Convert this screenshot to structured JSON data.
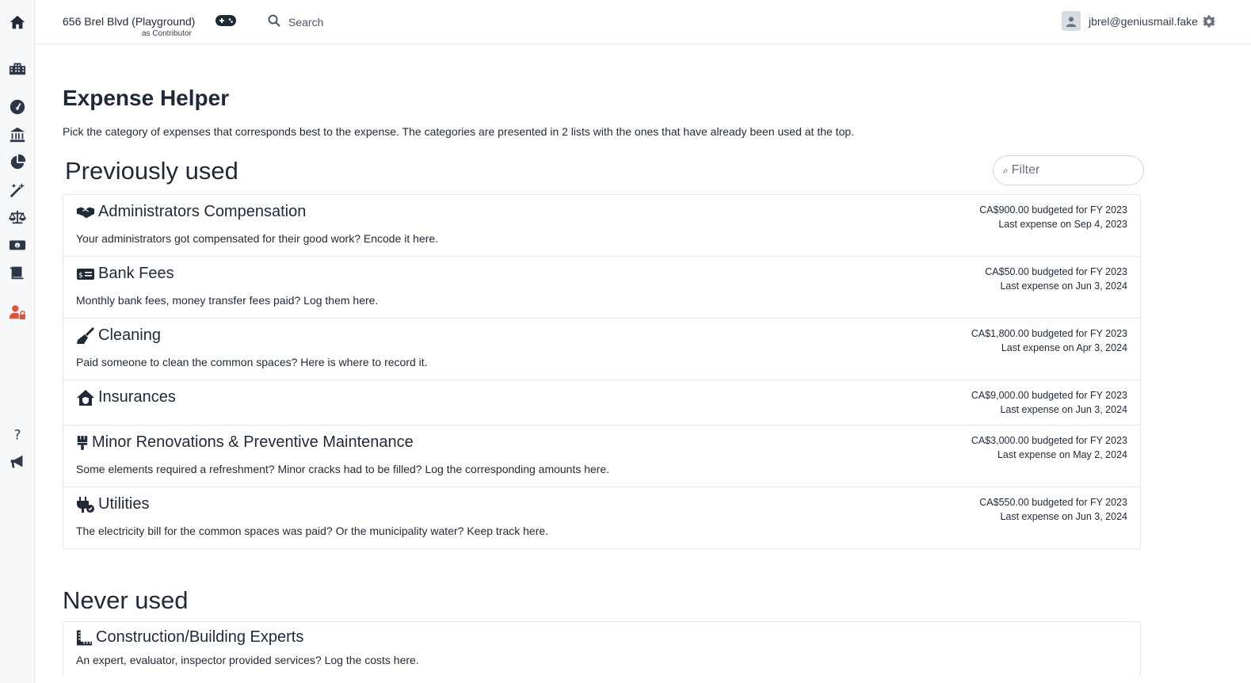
{
  "topbar": {
    "building_name": "656 Brel Blvd (Playground)",
    "building_role": "as Contributor",
    "search_placeholder": "Search",
    "user_email": "jbrel@geniusmail.fake"
  },
  "sidebar": {
    "icons": [
      "home-icon",
      "buildings-icon",
      "dashboard-icon",
      "bank-icon",
      "pie-chart-icon",
      "magic-wand-icon",
      "balance-scale-icon",
      "money-icon",
      "ledger-icon",
      "user-lock-icon",
      "help-icon",
      "announcement-icon"
    ]
  },
  "page": {
    "title": "Expense Helper",
    "description": "Pick the category of expenses that corresponds best to the expense. The categories are presented in 2 lists with the ones that have already been used at the top."
  },
  "previously_used": {
    "title": "Previously used",
    "filter_placeholder": "Filter",
    "items": [
      {
        "icon": "handshake-icon",
        "title": "Administrators Compensation",
        "description": "Your administrators got compensated for their good work? Encode it here.",
        "budget": "CA$900.00 budgeted for FY 2023",
        "last_expense": "Last expense on Sep 4, 2023"
      },
      {
        "icon": "money-check-icon",
        "title": "Bank Fees",
        "description": "Monthly bank fees, money transfer fees paid? Log them here.",
        "budget": "CA$50.00 budgeted for FY 2023",
        "last_expense": "Last expense on Jun 3, 2024"
      },
      {
        "icon": "broom-icon",
        "title": "Cleaning",
        "description": "Paid someone to clean the common spaces? Here is where to record it.",
        "budget": "CA$1,800.00 budgeted for FY 2023",
        "last_expense": "Last expense on Apr 3, 2024"
      },
      {
        "icon": "house-shield-icon",
        "title": "Insurances",
        "description": "",
        "budget": "CA$9,000.00 budgeted for FY 2023",
        "last_expense": "Last expense on Jun 3, 2024"
      },
      {
        "icon": "paint-brush-icon",
        "title": "Minor Renovations & Preventive Maintenance",
        "description": "Some elements required a refreshment? Minor cracks had to be filled? Log the corresponding amounts here.",
        "budget": "CA$3,000.00 budgeted for FY 2023",
        "last_expense": "Last expense on May 2, 2024"
      },
      {
        "icon": "plug-icon",
        "title": "Utilities",
        "description": "The electricity bill for the common spaces was paid? Or the municipality water? Keep track here.",
        "budget": "CA$550.00 budgeted for FY 2023",
        "last_expense": "Last expense on Jun 3, 2024"
      }
    ]
  },
  "never_used": {
    "title": "Never used",
    "items": [
      {
        "icon": "ruler-icon",
        "title": "Construction/Building Experts",
        "description": "An expert, evaluator, inspector provided services? Log the costs here."
      }
    ]
  }
}
